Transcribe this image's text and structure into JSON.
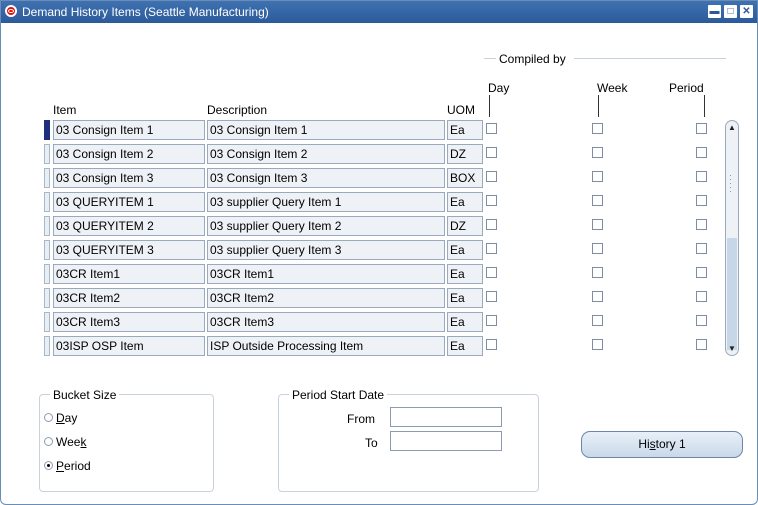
{
  "window": {
    "title": "Demand History Items (Seattle Manufacturing)",
    "minimize": "▬",
    "maximize": "□",
    "close": "✕"
  },
  "compiled_by": {
    "label": "Compiled by",
    "day": "Day",
    "week": "Week",
    "period": "Period"
  },
  "columns": {
    "item": "Item",
    "description": "Description",
    "uom": "UOM"
  },
  "rows": [
    {
      "item": "03 Consign Item 1",
      "description": "03 Consign Item 1",
      "uom": "Ea"
    },
    {
      "item": "03 Consign Item 2",
      "description": "03 Consign Item 2",
      "uom": "DZ"
    },
    {
      "item": "03 Consign Item 3",
      "description": "03 Consign Item 3",
      "uom": "BOX"
    },
    {
      "item": "03 QUERYITEM 1",
      "description": "03 supplier Query Item 1",
      "uom": "Ea"
    },
    {
      "item": "03 QUERYITEM 2",
      "description": "03 supplier Query Item 2",
      "uom": "DZ"
    },
    {
      "item": "03 QUERYITEM 3",
      "description": "03 supplier Query Item 3",
      "uom": "Ea"
    },
    {
      "item": "03CR Item1",
      "description": "03CR Item1",
      "uom": "Ea"
    },
    {
      "item": "03CR Item2",
      "description": "03CR Item2",
      "uom": "Ea"
    },
    {
      "item": "03CR Item3",
      "description": "03CR Item3",
      "uom": "Ea"
    },
    {
      "item": "03ISP OSP Item",
      "description": "ISP Outside Processing Item",
      "uom": "Ea"
    }
  ],
  "bucket_size": {
    "title": "Bucket Size",
    "day_pre": "",
    "day_key": "D",
    "day_post": "ay",
    "week_pre": "Wee",
    "week_key": "k",
    "week_post": "",
    "period_pre": "",
    "period_key": "P",
    "period_post": "eriod",
    "selected": "Period"
  },
  "period_start": {
    "title": "Period Start Date",
    "from_label": "From",
    "to_label": "To",
    "from_value": "",
    "to_value": ""
  },
  "history_button": {
    "pre": "Hi",
    "key": "s",
    "post": "tory 1"
  },
  "colors": {
    "title_bar": "#2b5a9a",
    "active_row": "#1f2f7a",
    "field_bg": "#eef2f6"
  }
}
